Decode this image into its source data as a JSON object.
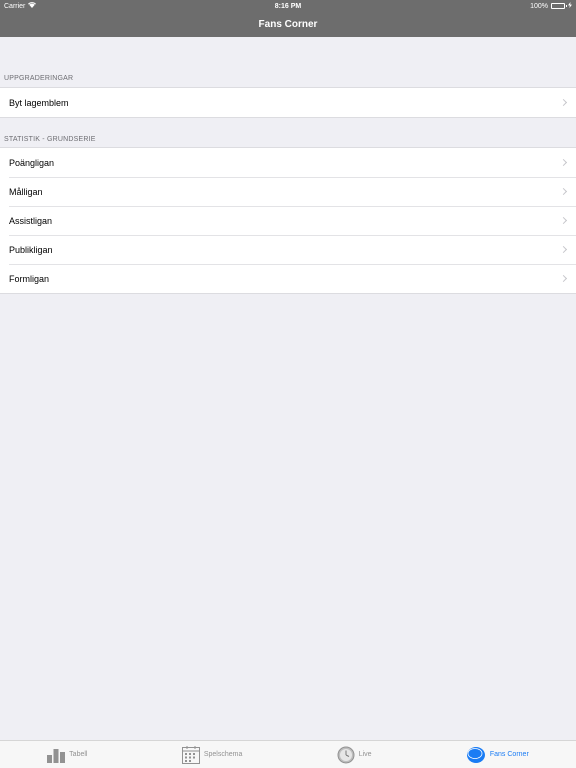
{
  "status": {
    "carrier": "Carrier",
    "time": "8:16 PM",
    "battery": "100%",
    "battery_level": 1.0
  },
  "navbar": {
    "title": "Fans Corner"
  },
  "sections": [
    {
      "header": "UPPGRADERINGAR",
      "rows": [
        {
          "label": "Byt lagemblem"
        }
      ]
    },
    {
      "header": "STATISTIK - GRUNDSERIE",
      "rows": [
        {
          "label": "Poängligan"
        },
        {
          "label": "Målligan"
        },
        {
          "label": "Assistligan"
        },
        {
          "label": "Publikligan"
        },
        {
          "label": "Formligan"
        }
      ]
    }
  ],
  "tabbar": {
    "tabs": [
      {
        "label": "Tabell",
        "icon": "bar-chart-icon",
        "active": false
      },
      {
        "label": "Spelschema",
        "icon": "calendar-icon",
        "active": false
      },
      {
        "label": "Live",
        "icon": "clock-icon",
        "active": false
      },
      {
        "label": "Fans Corner",
        "icon": "puck-icon",
        "active": true
      }
    ]
  },
  "colors": {
    "accent": "#1a7cf4",
    "navbar": "#6d6d6d",
    "background": "#efeff4"
  }
}
